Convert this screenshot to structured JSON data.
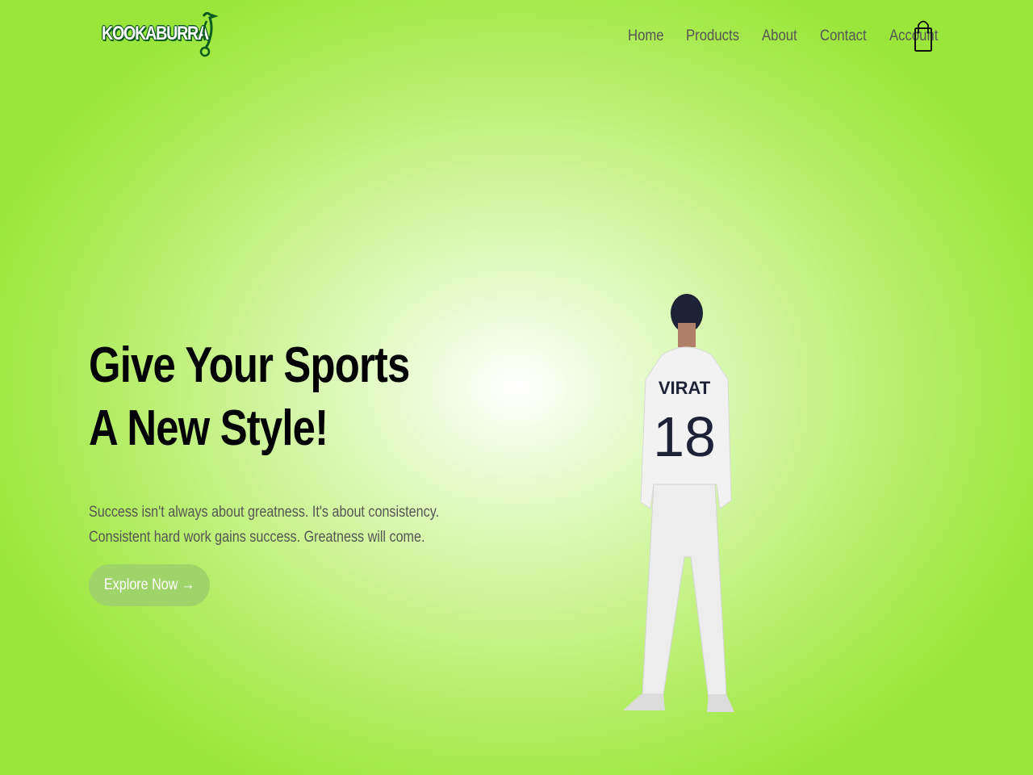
{
  "brand": {
    "logo_text": "KOOKABURRA"
  },
  "nav": {
    "items": [
      {
        "label": "Home"
      },
      {
        "label": "Products"
      },
      {
        "label": "About"
      },
      {
        "label": "Contact"
      },
      {
        "label": "Account"
      }
    ],
    "cart_icon": "shopping-bag-icon"
  },
  "hero": {
    "title_line1": "Give Your Sports",
    "title_line2": "A New Style!",
    "description": "Success isn't always about greatness. It's about consistency. Consistent hard work gains success. Greatness will come.",
    "cta_label": "Explore Now →",
    "image": {
      "jersey_name": "VIRAT",
      "jersey_number": "18"
    }
  },
  "colors": {
    "background_edge": "#9ae63a",
    "button": "#9fd46a",
    "logo_green": "#0b5a1f"
  }
}
